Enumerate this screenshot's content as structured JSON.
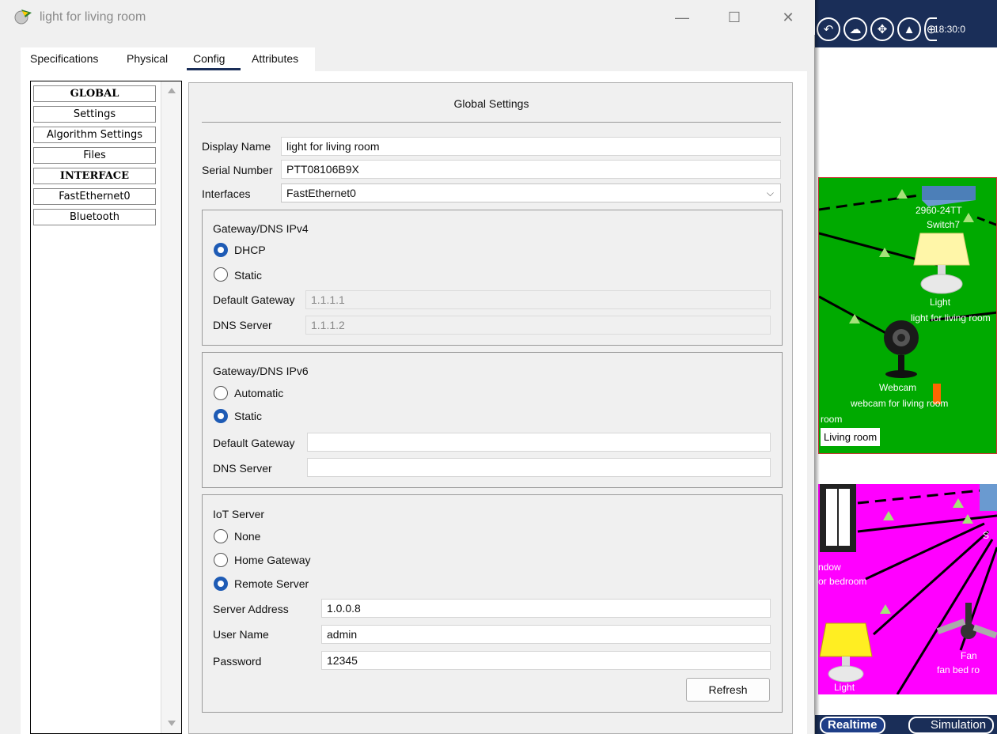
{
  "window": {
    "title": "light for living room",
    "minimize_icon": "—",
    "maximize_icon": "☐",
    "close_icon": "✕"
  },
  "tabs": [
    {
      "label": "Specifications",
      "active": false
    },
    {
      "label": "Physical",
      "active": false
    },
    {
      "label": "Config",
      "active": true
    },
    {
      "label": "Attributes",
      "active": false
    }
  ],
  "sidebar": {
    "items": [
      {
        "label": "GLOBAL",
        "kind": "header"
      },
      {
        "label": "Settings",
        "kind": "item"
      },
      {
        "label": "Algorithm Settings",
        "kind": "item"
      },
      {
        "label": "Files",
        "kind": "item"
      },
      {
        "label": "INTERFACE",
        "kind": "header"
      },
      {
        "label": "FastEthernet0",
        "kind": "item"
      },
      {
        "label": "Bluetooth",
        "kind": "item"
      }
    ]
  },
  "panel": {
    "title": "Global Settings",
    "display_name_label": "Display Name",
    "display_name_value": "light for living room",
    "serial_label": "Serial Number",
    "serial_value": "PTT08106B9X",
    "interfaces_label": "Interfaces",
    "interfaces_value": "FastEthernet0",
    "ipv4": {
      "title": "Gateway/DNS IPv4",
      "options": [
        "DHCP",
        "Static"
      ],
      "selected": "DHCP",
      "gateway_label": "Default Gateway",
      "gateway_value": "1.1.1.1",
      "dns_label": "DNS Server",
      "dns_value": "1.1.1.2"
    },
    "ipv6": {
      "title": "Gateway/DNS IPv6",
      "options": [
        "Automatic",
        "Static"
      ],
      "selected": "Static",
      "gateway_label": "Default Gateway",
      "gateway_value": "",
      "dns_label": "DNS Server",
      "dns_value": ""
    },
    "iot": {
      "title": "IoT Server",
      "options": [
        "None",
        "Home Gateway",
        "Remote Server"
      ],
      "selected": "Remote Server",
      "server_label": "Server Address",
      "server_value": "1.0.0.8",
      "user_label": "User Name",
      "user_value": "admin",
      "password_label": "Password",
      "password_value": "12345",
      "refresh_label": "Refresh"
    }
  },
  "workspace": {
    "clock": "18:30:0",
    "living_room": {
      "switch_model": "2960-24TT",
      "switch_name": "Switch7",
      "light_type": "Light",
      "light_name": "light for living room",
      "webcam_type": "Webcam",
      "webcam_name": "webcam for living room",
      "room_fragment": "room",
      "room_label": "Living room"
    },
    "bedroom": {
      "window_fragment_1": "ndow",
      "window_fragment_2": "or bedroom",
      "fan_type": "Fan",
      "fan_name": "fan bed ro",
      "light_type": "Light",
      "switch_fragment": "S"
    },
    "realtime_label": "Realtime",
    "simulation_label": "Simulation"
  },
  "colors": {
    "accent": "#1e5bb5",
    "toolbar": "#1a2e58",
    "living_room_bg": "#00aa00",
    "bedroom_bg": "#ff00ff"
  }
}
